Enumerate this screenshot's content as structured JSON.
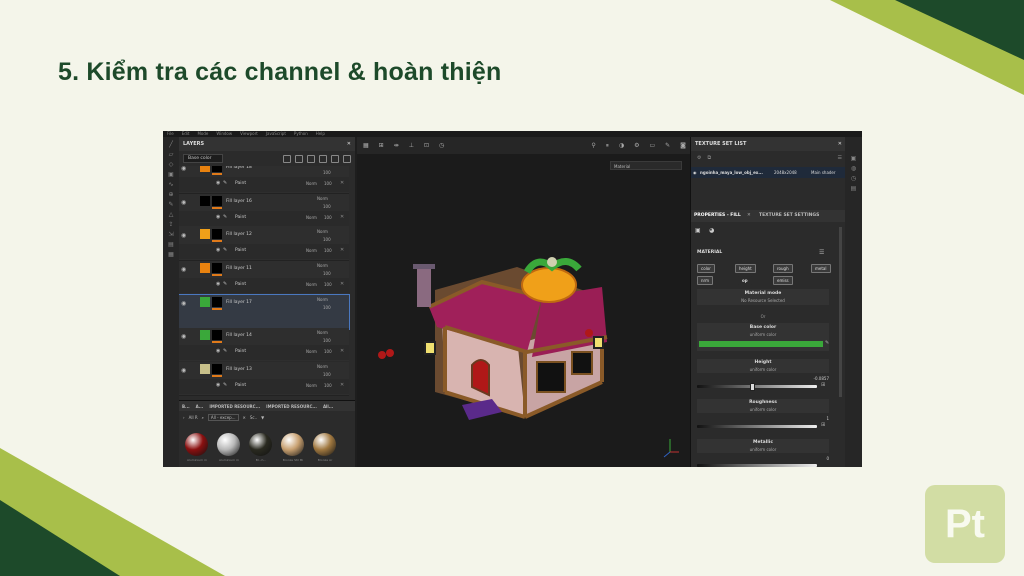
{
  "slide": {
    "title": "5. Kiểm tra các channel & hoàn thiện",
    "logo_text": "Pt",
    "colors": {
      "dark_green": "#1d4a2a",
      "olive": "#a8bf4a",
      "light_olive": "#d2dda4"
    }
  },
  "app": {
    "menu": [
      "File",
      "Edit",
      "Mode",
      "Window",
      "Viewport",
      "JavaScript",
      "Python",
      "Help"
    ],
    "layers_panel": {
      "title": "LAYERS",
      "channel_select": "Base color",
      "layers": [
        {
          "name": "Fill layer 18",
          "swatch": "#e8820f",
          "blend": "Norm",
          "opacity": "100",
          "sub": "Paint",
          "sub_blend": "Norm",
          "sub_opacity": "100"
        },
        {
          "name": "Fill layer 16",
          "swatch": "#000000",
          "blend": "Norm",
          "opacity": "100",
          "sub": "Paint",
          "sub_blend": "Norm",
          "sub_opacity": "100"
        },
        {
          "name": "Fill layer 12",
          "swatch": "#f0a019",
          "blend": "Norm",
          "opacity": "100",
          "sub": "Paint",
          "sub_blend": "Norm",
          "sub_opacity": "100"
        },
        {
          "name": "Fill layer 11",
          "swatch": "#e8820f",
          "blend": "Norm",
          "opacity": "100",
          "sub": "Paint",
          "sub_blend": "Norm",
          "sub_opacity": "100"
        },
        {
          "name": "Fill layer 17",
          "swatch": "#3aa83a",
          "blend": "Norm",
          "opacity": "100",
          "active": true
        },
        {
          "name": "Fill layer 14",
          "swatch": "#3aa83a",
          "blend": "Norm",
          "opacity": "100",
          "sub": "Paint",
          "sub_blend": "Norm",
          "sub_opacity": "100",
          "sub2": "Ambient Occlusion",
          "sub2_blend": "Norm",
          "sub2_opacity": "100"
        },
        {
          "name": "Fill layer 13",
          "swatch": "#c8c08a",
          "blend": "Norm",
          "opacity": "100",
          "sub": "Paint",
          "sub_blend": "Norm",
          "sub_opacity": "100"
        }
      ]
    },
    "shelf": {
      "tabs": [
        "B...",
        "A...",
        "IMPORTED RESOURC...",
        "IMPORTED RESOURC...",
        "All..."
      ],
      "filter_label": "All R",
      "search_placeholder": "All - excep...",
      "sort_label": "Sc..",
      "materials": [
        {
          "label": "Aluminium m",
          "color": "#8a1010"
        },
        {
          "label": "Aluminium m",
          "color": "#b8b8b8"
        },
        {
          "label": "Bl...h...",
          "color": "#2a2a20"
        },
        {
          "label": "Bronze Stil Mi",
          "color": "#c8a070"
        },
        {
          "label": "Bronze Ar",
          "color": "#a07840"
        }
      ]
    },
    "viewport": {
      "material_select": "Material"
    },
    "texture_set_list": {
      "title": "TEXTURE SET LIST",
      "row_name": "ngoinha_maya_low_obj_ex...",
      "row_size": "2048x2048",
      "row_shader": "Main shader"
    },
    "properties": {
      "tab_active": "PROPERTIES - FILL",
      "tab_other": "TEXTURE SET SETTINGS",
      "section": "MATERIAL",
      "channels": [
        "color",
        "height",
        "rough",
        "metal",
        "nrm",
        "op",
        "emiss"
      ],
      "material_mode_label": "Material mode",
      "material_mode_value": "No Resource Selected",
      "or_label": "Or",
      "base_color_label": "Base color",
      "base_color_sub": "uniform color",
      "base_color_value": "#3aa83a",
      "height_label": "Height",
      "height_sub": "uniform color",
      "height_value": "-0.0857",
      "roughness_label": "Roughness",
      "roughness_sub": "uniform color",
      "roughness_value": "1",
      "metallic_label": "Metallic",
      "metallic_sub": "uniform color",
      "metallic_value": "0"
    }
  }
}
